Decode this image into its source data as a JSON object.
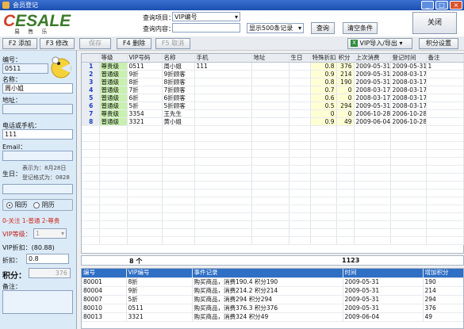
{
  "window": {
    "title": "会员登记"
  },
  "logo": {
    "brand_c": "C",
    "brand_rest": "ESALE",
    "sub": "易 售 乐"
  },
  "search": {
    "item_label": "查询项目：",
    "item_value": "VIP编号",
    "content_label": "查询内容：",
    "content_value": "",
    "limit_value": "显示500条记录",
    "query_btn": "查询",
    "clear_btn": "清空条件",
    "close_btn": "关闭"
  },
  "toolbar": {
    "add": "F2 添加",
    "edit": "F3 修改",
    "save": "保存",
    "delete": "F4 删除",
    "cancel": "F5 取消",
    "import_export": "VIP导入/导出",
    "points_settings": "积分设置"
  },
  "form": {
    "id_label": "编号：",
    "id_value": "0511",
    "name_label": "名称：",
    "name_value": "周小姐",
    "address_label": "地址：",
    "address_value": "",
    "phone_label": "电话或手机：",
    "phone_value": "111",
    "email_label": "Email：",
    "email_value": "",
    "birthday_label": "生日：",
    "birthday_hint1": "表示为：8月28日",
    "birthday_hint2": "登记格式为：0828",
    "birthday_value": "",
    "calendar_solar": "阳历",
    "calendar_lunar": "阴历",
    "level_legend": "0-关注 1-普通 2-尊贵",
    "vip_level_label": "VIP等级：",
    "vip_level_value": "1",
    "vip_discount_label": "VIP折扣：(80.88)",
    "discount_label": "折扣：",
    "discount_value": "0.8",
    "points_label": "积分：",
    "points_value": "376",
    "notes_label": "备注："
  },
  "members_table": {
    "columns": [
      "",
      "等级",
      "VIP号码",
      "名称",
      "手机",
      "地址",
      "生日",
      "特殊折扣",
      "积分",
      "上次消费",
      "登记时间",
      "备注"
    ],
    "rows": [
      {
        "n": "1",
        "level": "尊贵级",
        "vip": "0511",
        "name": "周小姐",
        "phone": "111",
        "addr": "",
        "bday": "",
        "disc": "0.8",
        "pts": "376",
        "last": "2009-05-31",
        "reg": "2009-05-31",
        "note": "1"
      },
      {
        "n": "2",
        "level": "普通级",
        "vip": "9折",
        "name": "9折顾客",
        "phone": "",
        "addr": "",
        "bday": "",
        "disc": "0.9",
        "pts": "214",
        "last": "2009-05-31",
        "reg": "2008-03-17",
        "note": ""
      },
      {
        "n": "3",
        "level": "普通级",
        "vip": "8折",
        "name": "8折顾客",
        "phone": "",
        "addr": "",
        "bday": "",
        "disc": "0.8",
        "pts": "190",
        "last": "2009-05-31",
        "reg": "2008-03-17",
        "note": ""
      },
      {
        "n": "4",
        "level": "普通级",
        "vip": "7折",
        "name": "7折顾客",
        "phone": "",
        "addr": "",
        "bday": "",
        "disc": "0.7",
        "pts": "0",
        "last": "2008-03-17",
        "reg": "2008-03-17",
        "note": ""
      },
      {
        "n": "5",
        "level": "普通级",
        "vip": "6折",
        "name": "6折顾客",
        "phone": "",
        "addr": "",
        "bday": "",
        "disc": "0.6",
        "pts": "0",
        "last": "2008-03-17",
        "reg": "2008-03-17",
        "note": ""
      },
      {
        "n": "6",
        "level": "普通级",
        "vip": "5折",
        "name": "5折顾客",
        "phone": "",
        "addr": "",
        "bday": "",
        "disc": "0.5",
        "pts": "294",
        "last": "2009-05-31",
        "reg": "2008-03-17",
        "note": ""
      },
      {
        "n": "7",
        "level": "尊贵级",
        "vip": "3354",
        "name": "王先生",
        "phone": "",
        "addr": "",
        "bday": "",
        "disc": "0",
        "pts": "0",
        "last": "2006-10-28",
        "reg": "2006-10-28",
        "note": ""
      },
      {
        "n": "8",
        "level": "普通级",
        "vip": "3321",
        "name": "黄小姐",
        "phone": "",
        "addr": "",
        "bday": "",
        "disc": "0.9",
        "pts": "49",
        "last": "2009-06-04",
        "reg": "2006-10-28",
        "note": ""
      }
    ]
  },
  "summary": {
    "count": "8 个",
    "total_points": "1123"
  },
  "history_table": {
    "columns": [
      "编号",
      "VIP编号",
      "事件记录",
      "时间",
      "增加积分"
    ],
    "rows": [
      {
        "id": "80001",
        "vip": "8折",
        "event": "购买商品，消费190.4  积分190",
        "time": "2009-05-31",
        "add": "190"
      },
      {
        "id": "80004",
        "vip": "9折",
        "event": "购买商品，消费214.2  积分214",
        "time": "2009-05-31",
        "add": "214"
      },
      {
        "id": "80007",
        "vip": "5折",
        "event": "购买商品，消费294  积分294",
        "time": "2009-05-31",
        "add": "294"
      },
      {
        "id": "80010",
        "vip": "0511",
        "event": "购买商品，消费376.3  积分376",
        "time": "2009-05-31",
        "add": "376"
      },
      {
        "id": "80013",
        "vip": "3321",
        "event": "购买商品，消费324  积分49",
        "time": "2009-06-04",
        "add": "49"
      }
    ]
  },
  "colors": {
    "title_bar": "#1b4fb0",
    "level_cell": "#c9f0ae",
    "value_cell": "#ffffd4",
    "history_header": "#2f6fc4",
    "left_panel": "#dbeaf7"
  }
}
